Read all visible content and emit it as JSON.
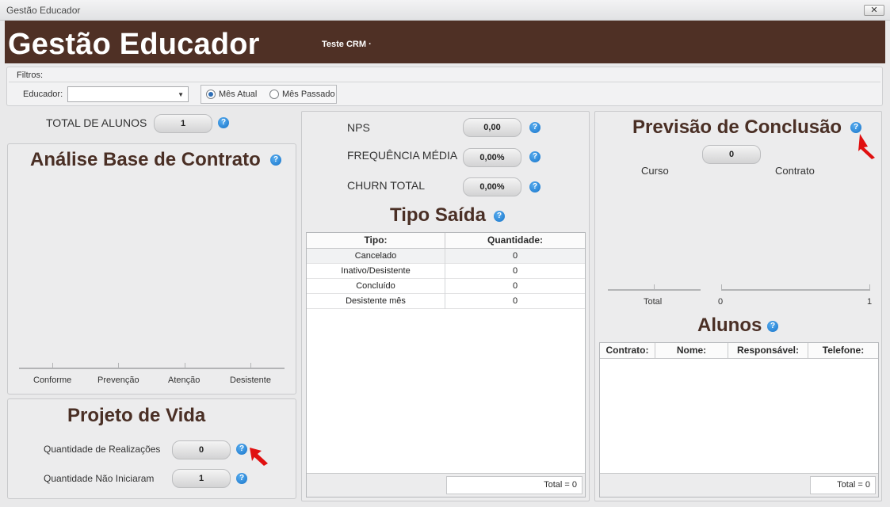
{
  "window": {
    "title": "Gestão Educador",
    "close_label": "✕"
  },
  "header": {
    "title": "Gestão Educador",
    "subtitle": "Teste CRM ·"
  },
  "filters": {
    "label": "Filtros:",
    "educador_label": "Educador:",
    "educador_value": "",
    "period_options": [
      {
        "label": "Mês Atual",
        "selected": true
      },
      {
        "label": "Mês Passado",
        "selected": false
      }
    ]
  },
  "left": {
    "total_alunos_label": "TOTAL DE ALUNOS",
    "total_alunos_value": "1",
    "analise": {
      "title": "Análise Base de Contrato",
      "categories": [
        "Conforme",
        "Prevenção",
        "Atenção",
        "Desistente"
      ]
    },
    "projeto": {
      "title": "Projeto de Vida",
      "realizacoes_label": "Quantidade de Realizações",
      "realizacoes_value": "0",
      "nao_iniciaram_label": "Quantidade Não Iniciaram",
      "nao_iniciaram_value": "1"
    }
  },
  "middle": {
    "nps_label": "NPS",
    "nps_value": "0,00",
    "frequencia_label": "FREQUÊNCIA MÉDIA",
    "frequencia_value": "0,00%",
    "churn_label": "CHURN TOTAL",
    "churn_value": "0,00%",
    "tipo_saida": {
      "title": "Tipo Saída",
      "columns": [
        "Tipo:",
        "Quantidade:"
      ],
      "rows": [
        [
          "Cancelado",
          "0"
        ],
        [
          "Inativo/Desistente",
          "0"
        ],
        [
          "Concluído",
          "0"
        ],
        [
          "Desistente mês",
          "0"
        ]
      ],
      "total": "Total = 0"
    }
  },
  "right": {
    "previsao": {
      "title": "Previsão de Conclusão",
      "value": "0",
      "curso_label": "Curso",
      "contrato_label": "Contrato",
      "axis_left_label": "Total",
      "axis_right_min": "0",
      "axis_right_max": "1"
    },
    "alunos": {
      "title": "Alunos",
      "columns": [
        "Contrato:",
        "Nome:",
        "Responsável:",
        "Telefone:"
      ],
      "total": "Total = 0"
    }
  },
  "help_glyph": "?",
  "colors": {
    "header_bg": "#4f3025",
    "title_color": "#4a2f25",
    "help_blue": "#1673c9",
    "annotation_arrow": "#e01010"
  }
}
